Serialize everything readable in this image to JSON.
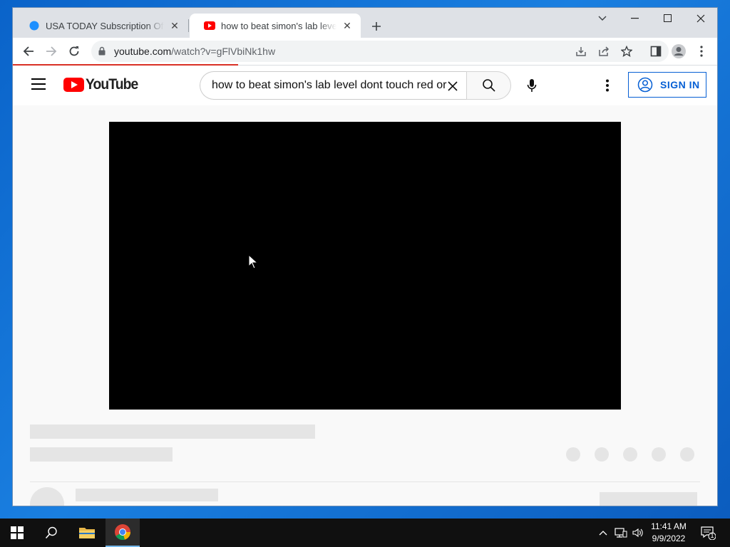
{
  "browser": {
    "tabs": [
      {
        "title": "USA TODAY Subscription Offers,",
        "active": false
      },
      {
        "title": "how to beat simon's lab level dont touch red",
        "active": true
      }
    ],
    "url_domain": "youtube.com",
    "url_path": "/watch?v=gFlVbiNk1hw",
    "accent_progress_color": "#d93025"
  },
  "youtube": {
    "logo_text": "YouTube",
    "search_query": "how to beat simon's lab level dont touch red  or",
    "sign_in_label": "SIGN IN",
    "brand_color": "#ff0000",
    "link_color": "#065fd4"
  },
  "taskbar": {
    "time": "11:41 AM",
    "date": "9/9/2022",
    "notification_count": "1"
  }
}
